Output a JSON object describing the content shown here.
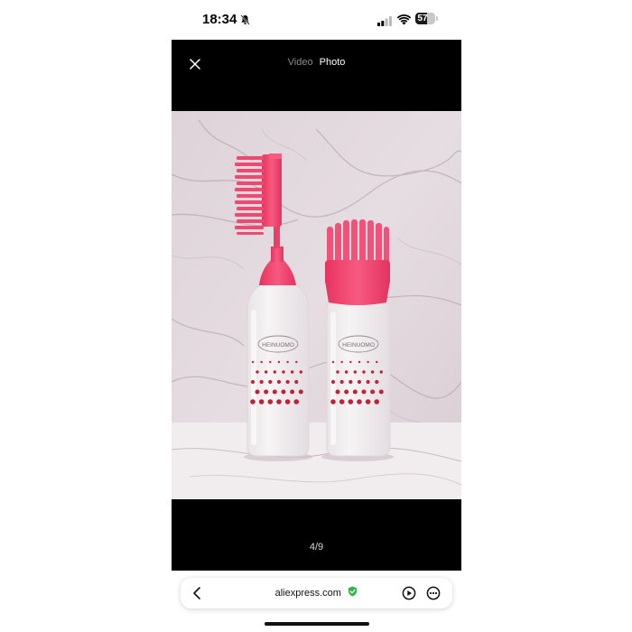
{
  "status_bar": {
    "time": "18:34",
    "battery_level": "57",
    "battery_fraction": 0.57,
    "icons": [
      "bell-slash-icon",
      "signal-icon",
      "wifi-icon",
      "battery-icon"
    ]
  },
  "viewer": {
    "tabs": [
      {
        "label": "Video",
        "active": false
      },
      {
        "label": "Photo",
        "active": true
      }
    ],
    "close_icon": "close-icon",
    "page_counter": "4/9",
    "photo": {
      "brand_mark_left": "HEINUOMO",
      "brand_mark_right": "HEINUOMO",
      "accent_color": "#f2456e",
      "dot_color": "#c0203a"
    }
  },
  "browser": {
    "url": "aliexpress.com",
    "secure_color": "#2eb44a",
    "icons": [
      "back-icon",
      "secure-check-icon",
      "play-icon",
      "more-icon"
    ]
  }
}
